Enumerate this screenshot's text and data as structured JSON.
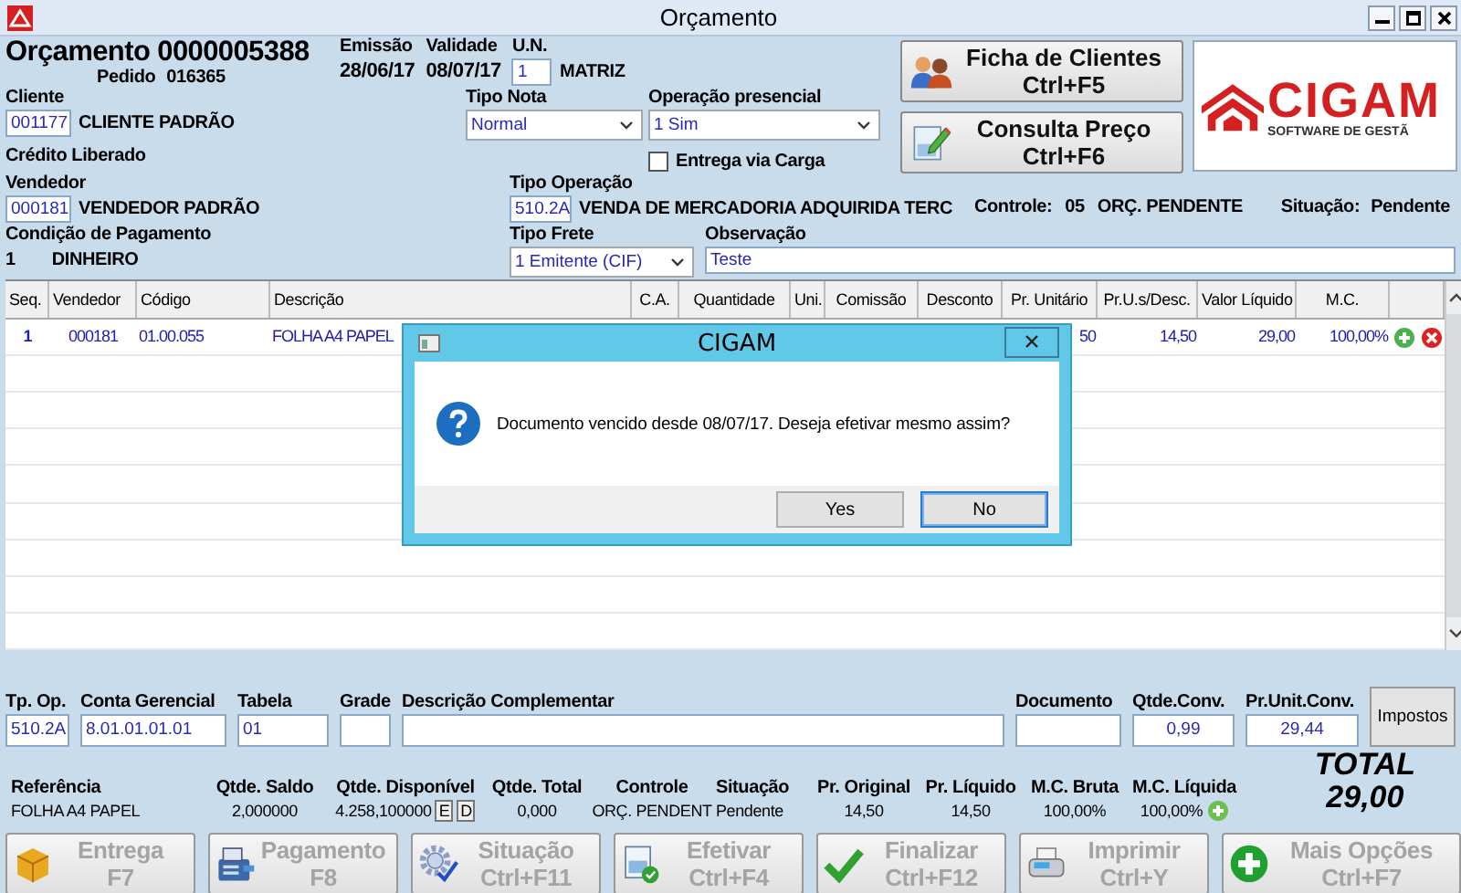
{
  "window": {
    "title": "Orçamento"
  },
  "header": {
    "title": "Orçamento 0000005388",
    "order_label": "Pedido",
    "order_number": "016365",
    "issue_label": "Emissão",
    "issue_date": "28/06/17",
    "validity_label": "Validade",
    "validity_date": "08/07/17",
    "unit_label": "U.N.",
    "unit_code": "1",
    "unit_name": "MATRIZ"
  },
  "client": {
    "label": "Cliente",
    "code": "001177",
    "name": "CLIENTE PADRÃO",
    "credit": "Crédito Liberado"
  },
  "invoice_type": {
    "label": "Tipo Nota",
    "value": "Normal"
  },
  "presence": {
    "label": "Operação presencial",
    "value": "1 Sim"
  },
  "load_delivery": {
    "label": "Entrega via Carga",
    "checked": false
  },
  "actions": [
    {
      "label": "Ficha de Clientes",
      "shortcut": "Ctrl+F5"
    },
    {
      "label": "Consulta Preço",
      "shortcut": "Ctrl+F6"
    }
  ],
  "logo": {
    "name": "CIGAM",
    "tagline": "SOFTWARE DE GESTÃ"
  },
  "seller": {
    "label": "Vendedor",
    "code": "000181",
    "name": "VENDEDOR PADRÃO"
  },
  "operation": {
    "label": "Tipo Operação",
    "code": "510.2A",
    "name": "VENDA DE MERCADORIA ADQUIRIDA TERC"
  },
  "control": {
    "label": "Controle:",
    "value": "05",
    "status": "ORÇ. PENDENTE"
  },
  "situation": {
    "label": "Situação:",
    "value": "Pendente"
  },
  "payment": {
    "label": "Condição de Pagamento",
    "code": "1",
    "name": "DINHEIRO"
  },
  "freight": {
    "label": "Tipo Frete",
    "value": "1 Emitente (CIF)"
  },
  "notes": {
    "label": "Observação",
    "value": "Teste"
  },
  "table": {
    "columns": [
      "Seq.",
      "Vendedor",
      "Código",
      "Descrição",
      "C.A.",
      "Quantidade",
      "Uni.",
      "Comissão",
      "Desconto",
      "Pr. Unitário",
      "Pr.U.s/Desc.",
      "Valor Líquido",
      "M.C."
    ],
    "rows": [
      {
        "cells": [
          "1",
          "000181",
          "01.00.055",
          "FOLHA A4 PAPEL",
          null,
          null,
          null,
          null,
          null,
          "50",
          "14,50",
          "29,00",
          "100,00%"
        ]
      }
    ]
  },
  "item_fields": [
    {
      "label": "Tp. Op.",
      "value": "510.2A"
    },
    {
      "label": "Conta Gerencial",
      "value": "8.01.01.01.01"
    },
    {
      "label": "Tabela",
      "value": "01"
    },
    {
      "label": "Grade"
    },
    {
      "label": "Descrição Complementar"
    },
    {
      "label": "Documento"
    },
    {
      "label": "Qtde.Conv.",
      "value": "0,99"
    },
    {
      "label": "Pr.Unit.Conv.",
      "value": "29,44"
    }
  ],
  "taxes_button": "Impostos",
  "summary": [
    {
      "label": "Referência",
      "value": "FOLHA A4 PAPEL"
    },
    {
      "label": "Qtde. Saldo",
      "value": "2,000000"
    },
    {
      "label": "Qtde. Disponível",
      "value": "4.258,100000",
      "buttons": [
        "E",
        "D"
      ]
    },
    {
      "label": "Qtde. Total",
      "value": "0,000"
    },
    {
      "label": "Controle",
      "value": "ORÇ. PENDENT"
    },
    {
      "label": "Situação",
      "value": "Pendente"
    },
    {
      "label": "Pr. Original",
      "value": "14,50"
    },
    {
      "label": "Pr. Líquido",
      "value": "14,50"
    },
    {
      "label": "M.C. Bruta",
      "value": "100,00%"
    },
    {
      "label": "M.C. Líquida",
      "value": "100,00%",
      "add": true
    }
  ],
  "total": {
    "label": "TOTAL",
    "value": "29,00"
  },
  "toolbar": [
    {
      "label": "Entrega",
      "shortcut": "F7",
      "disabled": true
    },
    {
      "label": "Pagamento",
      "shortcut": "F8",
      "disabled": true
    },
    {
      "label": "Situação",
      "shortcut": "Ctrl+F11",
      "disabled": true
    },
    {
      "label": "Efetivar",
      "shortcut": "Ctrl+F4",
      "disabled": true
    },
    {
      "label": "Finalizar",
      "shortcut": "Ctrl+F12",
      "disabled": true
    },
    {
      "label": "Imprimir",
      "shortcut": "Ctrl+Y",
      "disabled": true
    },
    {
      "label": "Mais Opções",
      "shortcut": "Ctrl+F7",
      "disabled": true
    }
  ],
  "dialog": {
    "title": "CIGAM",
    "message": "Documento vencido desde 08/07/17. Deseja efetivar mesmo assim?",
    "buttons": [
      {
        "label": "Yes",
        "focused": false
      },
      {
        "label": "No",
        "focused": true
      }
    ]
  }
}
